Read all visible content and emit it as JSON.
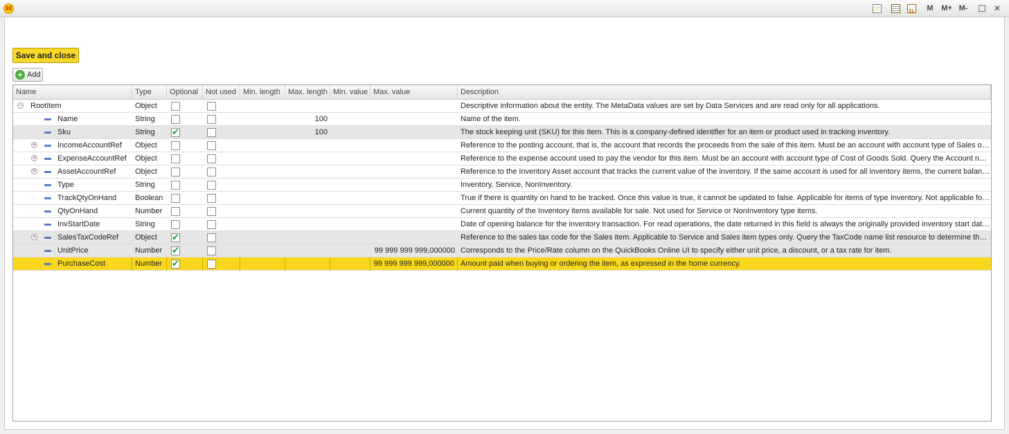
{
  "window": {
    "logo_text": "1C",
    "controls": {
      "m": "M",
      "m_plus": "M+",
      "m_minus": "M-",
      "restore": "☐",
      "close": "✕"
    },
    "icons": [
      "favorites-icon",
      "calculator-icon",
      "calendar-icon"
    ]
  },
  "toolbar": {
    "save_label": "Save and close",
    "add_label": "Add"
  },
  "grid": {
    "columns": [
      "Name",
      "Type",
      "Optional",
      "Not used",
      "Min. length",
      "Max. length",
      "Min. value",
      "Max. value",
      "Description"
    ],
    "rows": [
      {
        "name": "RootItem",
        "type": "Object",
        "optional": false,
        "not_used": false,
        "min_length": "",
        "max_length": "",
        "min_value": "",
        "max_value": "",
        "description": "Descriptive information about the entity. The MetaData values are set by Data Services and are read only for all applications.",
        "level": 0,
        "expander": "collapse",
        "state": "normal"
      },
      {
        "name": "Name",
        "type": "String",
        "optional": false,
        "not_used": false,
        "min_length": "",
        "max_length": "100",
        "min_value": "",
        "max_value": "",
        "description": "Name of the item.",
        "level": 1,
        "expander": "",
        "state": "normal"
      },
      {
        "name": "Sku",
        "type": "String",
        "optional": true,
        "not_used": false,
        "min_length": "",
        "max_length": "100",
        "min_value": "",
        "max_value": "",
        "description": "The stock keeping unit (SKU) for this Item. This is a company-defined identifier for an item or product used in tracking inventory.",
        "level": 1,
        "expander": "",
        "state": "shaded"
      },
      {
        "name": "IncomeAccountRef",
        "type": "Object",
        "optional": false,
        "not_used": false,
        "min_length": "",
        "max_length": "",
        "min_value": "",
        "max_value": "",
        "description": "Reference to the posting account, that is, the account that records the proceeds from the sale of this item. Must be an account with account type of Sales of Pr...",
        "level": 1,
        "expander": "expand",
        "state": "normal"
      },
      {
        "name": "ExpenseAccountRef",
        "type": "Object",
        "optional": false,
        "not_used": false,
        "min_length": "",
        "max_length": "",
        "min_value": "",
        "max_value": "",
        "description": "Reference to the expense account used to pay the vendor for this item. Must be an account with account type of Cost of Goods Sold. Query the Account name...",
        "level": 1,
        "expander": "expand",
        "state": "normal"
      },
      {
        "name": "AssetAccountRef",
        "type": "Object",
        "optional": false,
        "not_used": false,
        "min_length": "",
        "max_length": "",
        "min_value": "",
        "max_value": "",
        "description": "Reference to the Inventory Asset account that tracks the current value of the inventory. If the same account is used for all inventory items, the current balance ...",
        "level": 1,
        "expander": "expand",
        "state": "normal"
      },
      {
        "name": "Type",
        "type": "String",
        "optional": false,
        "not_used": false,
        "min_length": "",
        "max_length": "",
        "min_value": "",
        "max_value": "",
        "description": "Inventory, Service, NonInventory.",
        "level": 1,
        "expander": "",
        "state": "normal"
      },
      {
        "name": "TrackQtyOnHand",
        "type": "Boolean",
        "optional": false,
        "not_used": false,
        "min_length": "",
        "max_length": "",
        "min_value": "",
        "max_value": "",
        "description": "True if there is quantity on hand to be tracked. Once this value is true, it cannot be updated to false. Applicable for items of type Inventory. Not applicable for Se...",
        "level": 1,
        "expander": "",
        "state": "normal"
      },
      {
        "name": "QtyOnHand",
        "type": "Number",
        "optional": false,
        "not_used": false,
        "min_length": "",
        "max_length": "",
        "min_value": "",
        "max_value": "",
        "description": "Current quantity of the Inventory items available for sale. Not used for Service or NonInventory type items.",
        "level": 1,
        "expander": "",
        "state": "normal"
      },
      {
        "name": "InvStartDate",
        "type": "String",
        "optional": false,
        "not_used": false,
        "min_length": "",
        "max_length": "",
        "min_value": "",
        "max_value": "",
        "description": "Date of opening balance for the inventory transaction. For read operations, the date returned in this field is always the originally provided inventory start date. For...",
        "level": 1,
        "expander": "",
        "state": "normal"
      },
      {
        "name": "SalesTaxCodeRef",
        "type": "Object",
        "optional": true,
        "not_used": false,
        "min_length": "",
        "max_length": "",
        "min_value": "",
        "max_value": "",
        "description": "Reference to the sales tax code for the Sales item. Applicable to Service and Sales item types only. Query the TaxCode name list resource to determine the appr...",
        "level": 1,
        "expander": "expand",
        "state": "shaded"
      },
      {
        "name": "UnitPrice",
        "type": "Number",
        "optional": true,
        "not_used": false,
        "min_length": "",
        "max_length": "",
        "min_value": "",
        "max_value": "99 999 999 999,000000",
        "description": "Corresponds to the Price/Rate column on the QuickBooks Online UI to specify either unit price, a discount, or a tax rate for item.",
        "level": 1,
        "expander": "",
        "state": "shaded"
      },
      {
        "name": "PurchaseCost",
        "type": "Number",
        "optional": true,
        "not_used": false,
        "min_length": "",
        "max_length": "",
        "min_value": "",
        "max_value": "99 999 999 999,000000",
        "description": "Amount paid when buying or ordering the item, as expressed in the home currency.",
        "level": 1,
        "expander": "",
        "state": "selected"
      }
    ]
  }
}
